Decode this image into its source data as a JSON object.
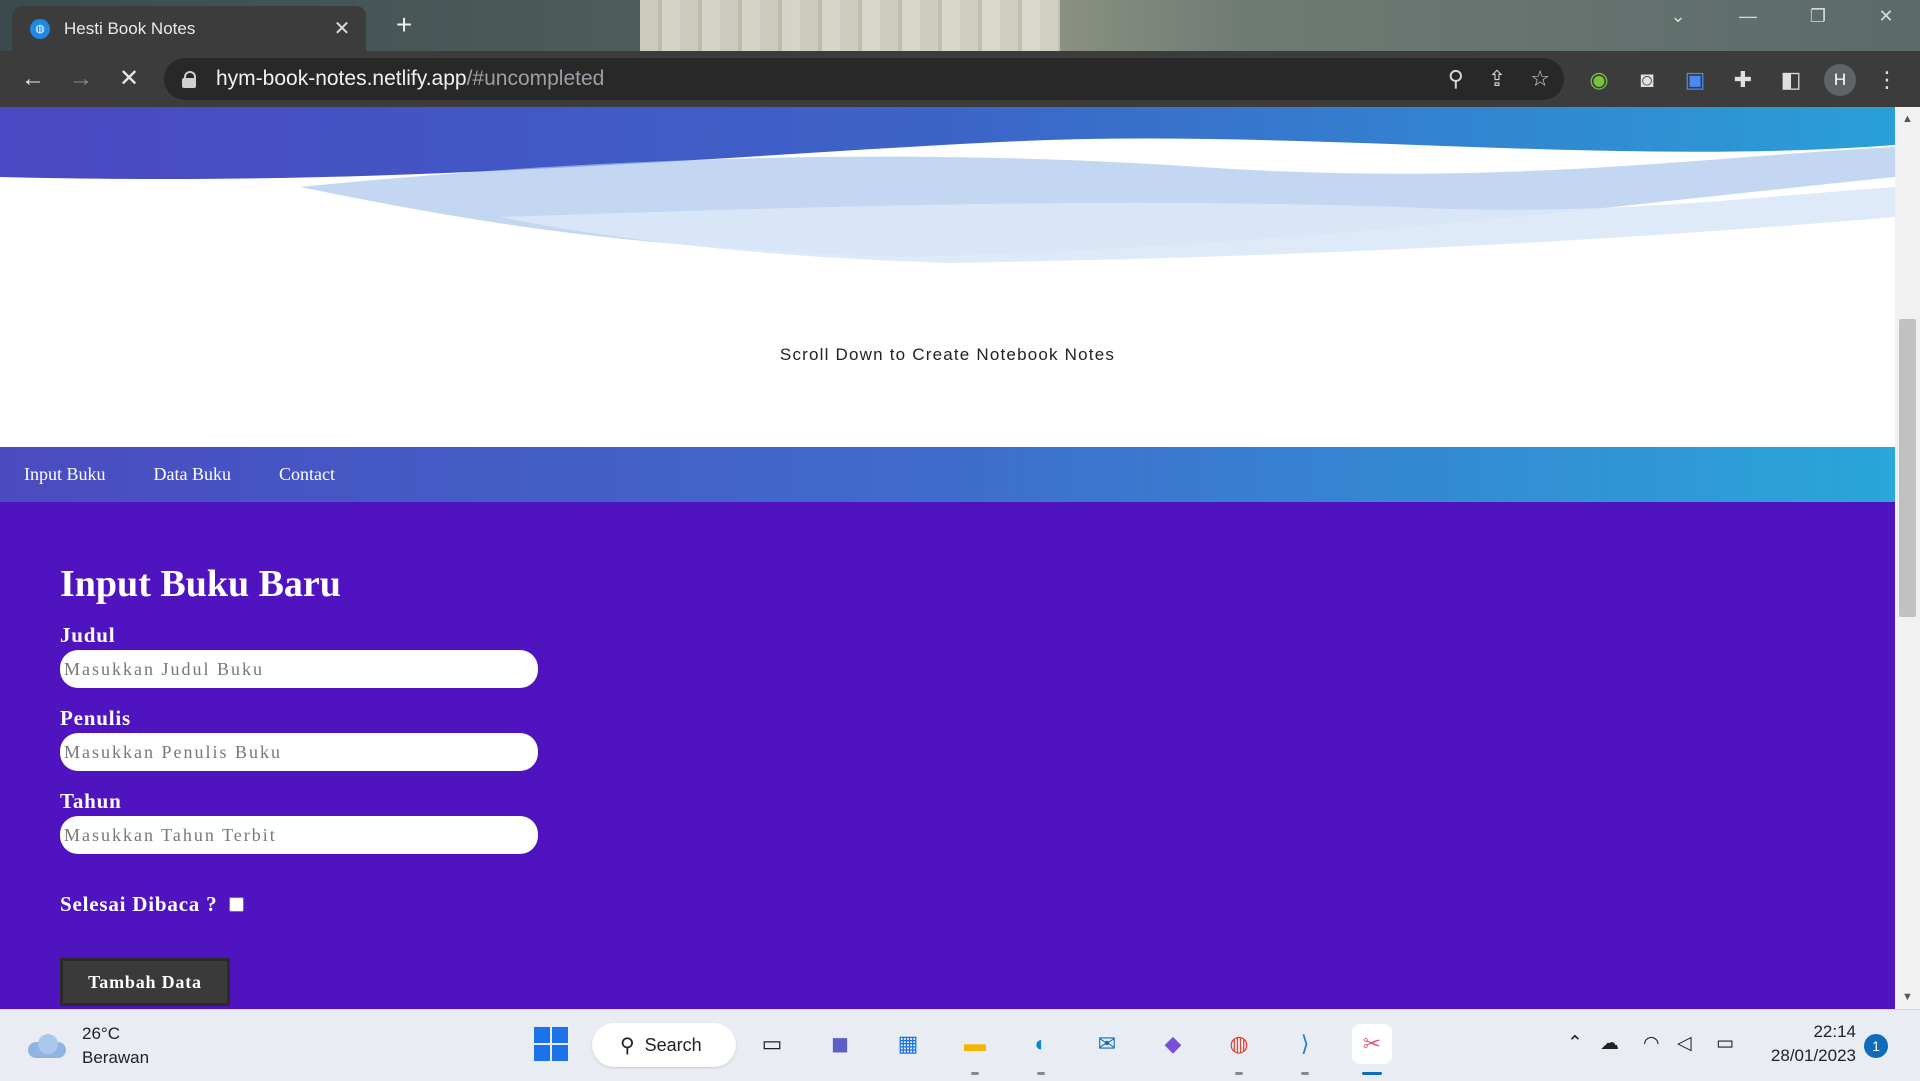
{
  "browser": {
    "tab_title": "Hesti Book Notes",
    "url_host": "hym-book-notes.netlify.app",
    "url_path": "/#uncompleted",
    "profile_initial": "H"
  },
  "hero": {
    "scroll_text": "Scroll Down to Create Notebook Notes"
  },
  "nav": {
    "items": [
      "Input Buku",
      "Data Buku",
      "Contact"
    ]
  },
  "form": {
    "title": "Input Buku Baru",
    "judul_label": "Judul",
    "judul_placeholder": "Masukkan Judul Buku",
    "penulis_label": "Penulis",
    "penulis_placeholder": "Masukkan Penulis Buku",
    "tahun_label": "Tahun",
    "tahun_placeholder": "Masukkan Tahun Terbit",
    "selesai_label": "Selesai Dibaca ?",
    "submit_label": "Tambah Data"
  },
  "taskbar": {
    "weather_temp": "26°C",
    "weather_desc": "Berawan",
    "search_label": "Search",
    "time": "22:14",
    "date": "28/01/2023",
    "notification_count": "1"
  },
  "colors": {
    "form_bg": "#4f14bf",
    "nav_gradient_start": "#4a4bc0",
    "nav_gradient_end": "#2aa6d8"
  }
}
